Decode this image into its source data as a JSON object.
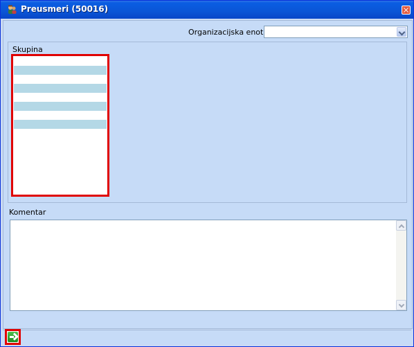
{
  "window": {
    "title": "Preusmeri (50016)",
    "icon": "users-icon",
    "close_icon": "close-icon"
  },
  "org_unit": {
    "label": "Organizacijska enota:",
    "value": ""
  },
  "group_section": {
    "label": "Skupina",
    "rows": [
      "",
      "",
      "",
      "",
      "",
      "",
      "",
      "",
      ""
    ]
  },
  "comment": {
    "label": "Komentar",
    "value": ""
  },
  "footer": {
    "next_icon": "arrow-right-icon"
  },
  "colors": {
    "title_bar": "#0a55d6",
    "panel_bg": "#c6dbf7",
    "highlight": "#e00000",
    "list_alt_row": "#b4d8e6"
  }
}
